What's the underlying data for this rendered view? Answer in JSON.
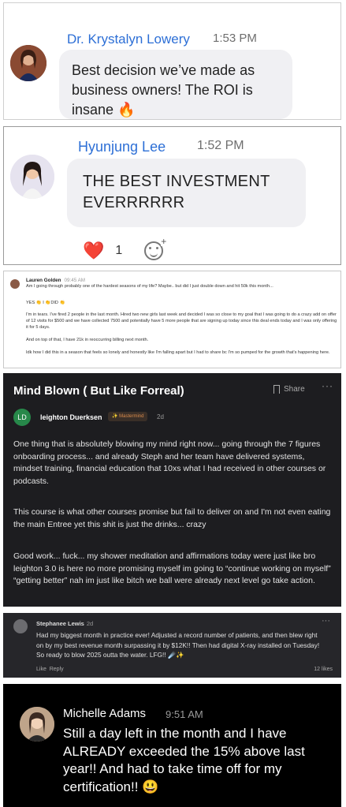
{
  "panel1": {
    "name": "Dr. Krystalyn Lowery",
    "time": "1:53 PM",
    "message": "Best decision we’ve made as business owners! The ROI is insane 🔥"
  },
  "panel2": {
    "name": "Hyunjung Lee",
    "time": "1:52 PM",
    "message": "THE BEST INVESTMENT EVERRRRRR",
    "reaction_emoji": "❤️",
    "reaction_count": "1",
    "add_reaction_icon": "add-emoji-icon"
  },
  "panel3": {
    "name": "Lauren Golden",
    "time": "09:45 AM",
    "line1": "Am I going through probably one of the hardest seasons of my life? Maybe.. but did I just double down and hit 50k this month...",
    "line2": "YES 👏 I 👏DID 👏",
    "line3": "I'm in tears. I've fired 2 people in the last month. Hired two new girls last week and decided I was so close to my goal that I was going to do a crazy add on offer of 12 visits for $500 and we have collected 7500 and potentially have 5 more people that are signing up today since this deal ends today and I was only offering it for 5 days.",
    "line4": "And on top of that, I have 21k in reoccurring billing next month.",
    "line5": "Idk how I did this in a season that feels so lonely and honestly like I'm falling apart but I had to share bc I'm so pumped for the growth that's happening here."
  },
  "panel4": {
    "title": "Mind Blown ( But Like Forreal)",
    "share_label": "Share",
    "more_label": "···",
    "initials": "LD",
    "author": "leighton Duerksen",
    "badge": "✨ Mastermind",
    "age": "2d",
    "para1": "One thing that is absolutely blowing my mind right now... going through the 7 figures onboarding process... and already Steph and her team have delivered systems, mindset training, financial education that 10xs what I had received in other courses or podcasts.",
    "para2": "This course is what other courses promise but fail to deliver on and I'm not even eating the main Entree yet this shit is just the drinks... crazy",
    "para3": "Good work... fuck... my shower meditation and  affirmations today were just like bro leighton 3.0 is here no more promising myself im going to “continue working on myself” “getting better” nah im just like bitch we ball were already next level go take action."
  },
  "panel5": {
    "name": "Stephanee Lewis",
    "age": "2d",
    "more_label": "···",
    "message": "Had my biggest month in practice ever! Adjusted a record number of patients, and then blew right on by my best revenue month surpassing it by $12K!! Then had digital X-ray installed on Tuesday! So ready to blow 2025 outta the water. LFG!! ☄️✨",
    "like_label": "Like",
    "reply_label": "Reply",
    "likes": "12 likes"
  },
  "panel6": {
    "name": "Michelle Adams",
    "time": "9:51 AM",
    "message": "Still a day left in the month and I have ALREADY exceeded the 15% above last year!! And had to take time off for my certification!! 😃"
  }
}
